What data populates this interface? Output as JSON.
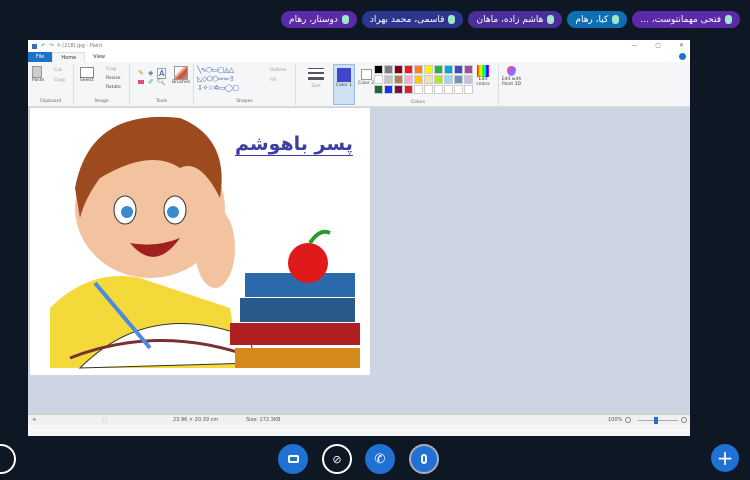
{
  "participants": [
    {
      "name": "فتحی مهمانتوست، ...",
      "color": "#5a2aa8"
    },
    {
      "name": "کیا، رهام",
      "color": "#0f6fb5"
    },
    {
      "name": "هاشم زاده، ماهان",
      "color": "#4a2f9a"
    },
    {
      "name": "قاسمی، محمد بهراد",
      "color": "#2c3590"
    },
    {
      "name": "دوستار، رهام",
      "color": "#5a2aa8"
    }
  ],
  "paint": {
    "title": "h (218).jpg - Paint",
    "tabs": [
      "File",
      "Home",
      "View"
    ],
    "groups": {
      "clipboard": "Clipboard",
      "image": "Image",
      "tools": "Tools",
      "shapes": "Shapes",
      "colors": "Colors"
    },
    "buttons": {
      "paste": "Paste",
      "cut": "Cut",
      "copy": "Copy",
      "select": "Select",
      "crop": "Crop",
      "resize": "Resize",
      "rotate": "Rotate",
      "brushes": "Brushes",
      "outline": "Outline",
      "fill": "Fill",
      "size": "Size",
      "color1": "Color 1",
      "color2": "Color 2",
      "edit_colors": "Edit colors",
      "paint3d": "Edit with Paint 3D"
    },
    "palette": [
      "#000000",
      "#7f7f7f",
      "#880015",
      "#ed1c24",
      "#ff7f27",
      "#fff200",
      "#22b14c",
      "#00a2e8",
      "#3f48cc",
      "#a349a4",
      "#ffffff",
      "#c3c3c3",
      "#b97a57",
      "#ffaec9",
      "#ffc90e",
      "#efe4b0",
      "#b5e61d",
      "#99d9ea",
      "#7092be",
      "#c8bfe7",
      "#1e6b2e",
      "#1a32f0",
      "#7a0e3c",
      "#d9222a"
    ],
    "color1": "#3f48cc",
    "image_text": "پسر باهوشم",
    "status": {
      "dimensions": "23.96 × 20.39 cm",
      "size": "Size: 172.3KB",
      "zoom": "100%"
    },
    "zoom_level": 100
  },
  "controls": [
    "screen-share",
    "camera-off",
    "hang-up",
    "microphone"
  ]
}
